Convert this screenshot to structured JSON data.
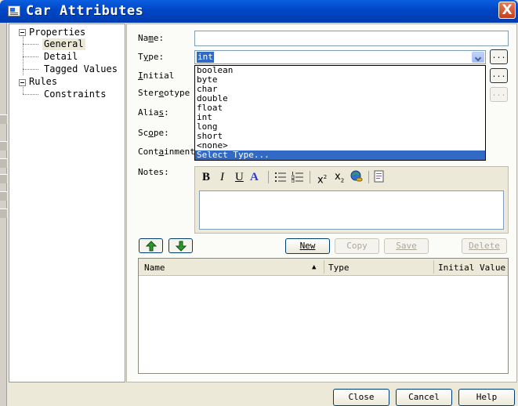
{
  "window": {
    "title": "Car Attributes",
    "close_label": "X"
  },
  "tree": {
    "properties": "Properties",
    "general": "General",
    "detail": "Detail",
    "tagged_values": "Tagged Values",
    "rules": "Rules",
    "constraints": "Constraints"
  },
  "form": {
    "name_label_pre": "Na",
    "name_label_acc": "m",
    "name_label_post": "e:",
    "type_label_pre": "T",
    "type_label_acc": "y",
    "type_label_post": "pe:",
    "initial_label_pre": "",
    "initial_label_acc": "I",
    "initial_label_post": "nitial",
    "stereotype_label_pre": "Ster",
    "stereotype_label_acc": "e",
    "stereotype_label_post": "otype",
    "alias_label_pre": "Alia",
    "alias_label_acc": "s",
    "alias_label_post": ":",
    "scope_label_pre": "Sc",
    "scope_label_acc": "o",
    "scope_label_post": "pe:",
    "containment_label_pre": "Cont",
    "containment_label_acc": "a",
    "containment_label_post": "inment",
    "notes_label": "Notes:",
    "name_value": "",
    "type_value": "int",
    "browse_label": "..."
  },
  "type_dropdown": {
    "options": [
      "boolean",
      "byte",
      "char",
      "double",
      "float",
      "int",
      "long",
      "short",
      "<none>",
      "Select Type..."
    ],
    "highlighted": "Select Type..."
  },
  "notes_toolbar": [
    "bold",
    "italic",
    "underline",
    "font-color",
    "bullet-list",
    "numbered-list",
    "superscript",
    "subscript",
    "hyperlink",
    "document"
  ],
  "toolbar_glyphs": {
    "bold": "B",
    "italic": "I",
    "underline": "U",
    "fontcolor": "A",
    "sup": "x",
    "sup_n": "2",
    "sub": "x",
    "sub_n": "2"
  },
  "actions": {
    "new": "New",
    "copy": "Copy",
    "save": "Save",
    "delete": "Delete"
  },
  "grid": {
    "columns": [
      "Name",
      "Type",
      "Initial Value"
    ],
    "sort_indicator": "▲"
  },
  "dialog_buttons": {
    "close": "Close",
    "cancel": "Cancel",
    "help": "Help"
  },
  "colors": {
    "titlebar": "#0a5fe0",
    "selection": "#316ac5",
    "face": "#ece9d8"
  }
}
